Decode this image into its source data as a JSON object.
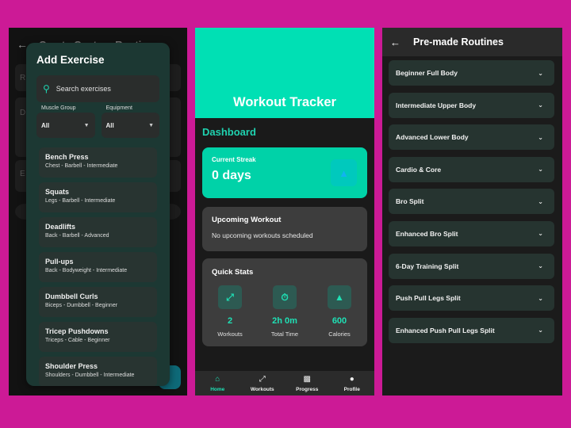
{
  "screen1": {
    "background_title": "Create Custom Routine",
    "modal": {
      "title": "Add Exercise",
      "search_placeholder": "Search exercises",
      "search_icon": "search-icon",
      "filters": [
        {
          "label": "Muscle Group",
          "value": "All"
        },
        {
          "label": "Equipment",
          "value": "All"
        }
      ],
      "exercises": [
        {
          "name": "Bench Press",
          "meta": "Chest - Barbell - Intermediate"
        },
        {
          "name": "Squats",
          "meta": "Legs - Barbell - Intermediate"
        },
        {
          "name": "Deadlifts",
          "meta": "Back - Barbell - Advanced"
        },
        {
          "name": "Pull-ups",
          "meta": "Back - Bodyweight - Intermediate"
        },
        {
          "name": "Dumbbell Curls",
          "meta": "Biceps - Dumbbell - Beginner"
        },
        {
          "name": "Tricep Pushdowns",
          "meta": "Triceps - Cable - Beginner"
        },
        {
          "name": "Shoulder Press",
          "meta": "Shoulders - Dumbbell - Intermediate"
        }
      ]
    }
  },
  "screen2": {
    "app_title": "Workout Tracker",
    "section_title": "Dashboard",
    "streak": {
      "label": "Current Streak",
      "value": "0 days",
      "icon": "fire-icon"
    },
    "upcoming": {
      "title": "Upcoming Workout",
      "text": "No upcoming workouts scheduled"
    },
    "quick_stats": {
      "title": "Quick Stats",
      "items": [
        {
          "icon": "dumbbell-icon",
          "value": "2",
          "label": "Workouts"
        },
        {
          "icon": "stopwatch-icon",
          "value": "2h 0m",
          "label": "Total Time"
        },
        {
          "icon": "fire-icon",
          "value": "600",
          "label": "Calories"
        }
      ]
    },
    "nav": [
      {
        "label": "Home",
        "icon": "home-icon",
        "active": true
      },
      {
        "label": "Workouts",
        "icon": "dumbbell-icon",
        "active": false
      },
      {
        "label": "Progress",
        "icon": "chart-icon",
        "active": false
      },
      {
        "label": "Profile",
        "icon": "person-icon",
        "active": false
      }
    ],
    "colors": {
      "accent": "#1fe0b5",
      "hero": "#00e0b4"
    }
  },
  "screen3": {
    "title": "Pre-made Routines",
    "routines": [
      "Beginner Full Body",
      "Intermediate Upper Body",
      "Advanced Lower Body",
      "Cardio & Core",
      "Bro Split",
      "Enhanced Bro Split",
      "6-Day Training Split",
      "Push Pull Legs Split",
      "Enhanced Push Pull Legs Split"
    ]
  }
}
